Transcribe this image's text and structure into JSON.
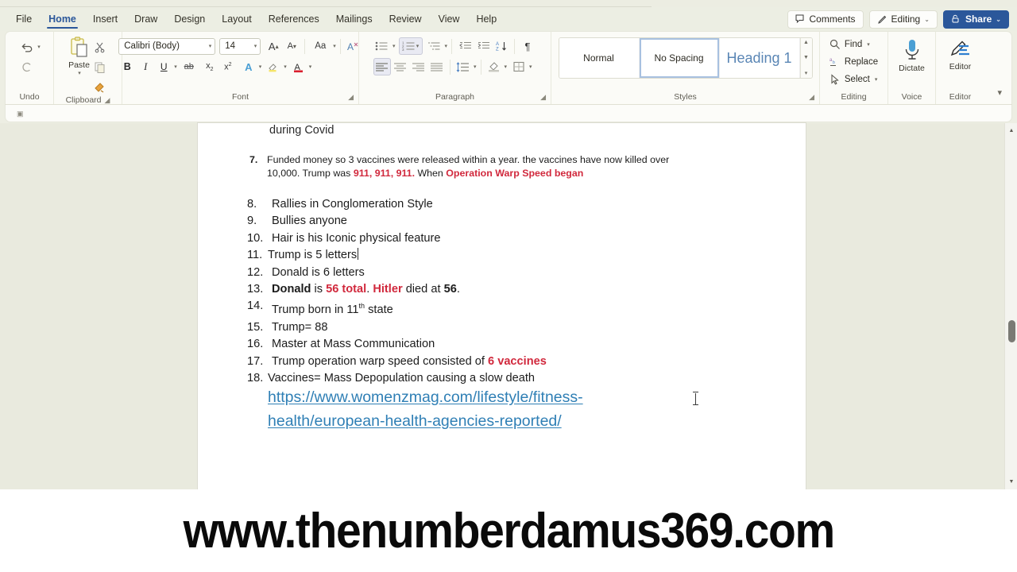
{
  "app": {
    "name": "Microsoft Word",
    "theme_accent": "#2b579a",
    "canvas_bg": "#e9eade",
    "ribbon_bg": "#fbfbf7"
  },
  "tabs": [
    {
      "label": "File",
      "active": false
    },
    {
      "label": "Home",
      "active": true
    },
    {
      "label": "Insert",
      "active": false
    },
    {
      "label": "Draw",
      "active": false
    },
    {
      "label": "Design",
      "active": false
    },
    {
      "label": "Layout",
      "active": false
    },
    {
      "label": "References",
      "active": false
    },
    {
      "label": "Mailings",
      "active": false
    },
    {
      "label": "Review",
      "active": false
    },
    {
      "label": "View",
      "active": false
    },
    {
      "label": "Help",
      "active": false
    }
  ],
  "titlebar_actions": {
    "comments": {
      "label": "Comments",
      "icon": "comment-icon"
    },
    "editing": {
      "label": "Editing",
      "icon": "pencil-icon",
      "caret": "⌄"
    },
    "share": {
      "label": "Share",
      "icon": "share-lock-icon",
      "caret": "⌄"
    }
  },
  "ribbon": {
    "groups": [
      {
        "name": "Undo",
        "label": "Undo",
        "items": [
          {
            "name": "undo-button",
            "icon": "undo-arrow-icon",
            "caret": "⌄"
          },
          {
            "name": "redo-button",
            "icon": "redo-arrow-icon"
          }
        ]
      },
      {
        "name": "Clipboard",
        "label": "Clipboard",
        "items": [
          {
            "name": "paste-button",
            "label": "Paste",
            "icon": "clipboard-icon",
            "caret": "⌄"
          },
          {
            "name": "cut-button",
            "icon": "scissors-icon"
          },
          {
            "name": "copy-button",
            "icon": "copy-icon"
          },
          {
            "name": "format-painter-button",
            "icon": "format-painter-icon"
          }
        ]
      },
      {
        "name": "Font",
        "label": "Font",
        "font_name": "Calibri (Body)",
        "font_size": "14",
        "items": [
          {
            "name": "grow-font-button",
            "label": "A",
            "icon": "grow-font-icon"
          },
          {
            "name": "shrink-font-button",
            "label": "A",
            "icon": "shrink-font-icon"
          },
          {
            "name": "change-case-button",
            "label": "Aa",
            "icon": "change-case-icon"
          },
          {
            "name": "clear-formatting-button",
            "icon": "clear-formatting-icon"
          },
          {
            "name": "bold-button",
            "label": "B",
            "icon": "bold-icon"
          },
          {
            "name": "italic-button",
            "label": "I",
            "icon": "italic-icon"
          },
          {
            "name": "underline-button",
            "label": "U",
            "icon": "underline-icon"
          },
          {
            "name": "strikethrough-button",
            "label": "ab",
            "icon": "strikethrough-icon"
          },
          {
            "name": "subscript-button",
            "label": "x",
            "icon": "subscript-icon"
          },
          {
            "name": "superscript-button",
            "label": "x",
            "icon": "superscript-icon"
          },
          {
            "name": "text-effects-button",
            "label": "A",
            "icon": "text-effects-icon"
          },
          {
            "name": "text-highlight-button",
            "label": "",
            "icon": "highlighter-icon"
          },
          {
            "name": "font-color-button",
            "label": "A",
            "icon": "font-color-icon"
          }
        ]
      },
      {
        "name": "Paragraph",
        "label": "Paragraph",
        "items": [
          {
            "name": "bullets-button",
            "icon": "bullet-list-icon"
          },
          {
            "name": "numbering-button",
            "icon": "numbered-list-icon",
            "selected": true
          },
          {
            "name": "multilevel-list-button",
            "icon": "multilevel-list-icon"
          },
          {
            "name": "decrease-indent-button",
            "icon": "decrease-indent-icon"
          },
          {
            "name": "increase-indent-button",
            "icon": "increase-indent-icon"
          },
          {
            "name": "sort-button",
            "icon": "sort-az-icon"
          },
          {
            "name": "show-marks-button",
            "icon": "pilcrow-icon"
          },
          {
            "name": "align-left-button",
            "icon": "align-left-icon",
            "selected": true
          },
          {
            "name": "align-center-button",
            "icon": "align-center-icon"
          },
          {
            "name": "align-right-button",
            "icon": "align-right-icon"
          },
          {
            "name": "justify-button",
            "icon": "justify-icon"
          },
          {
            "name": "line-spacing-button",
            "icon": "line-spacing-icon"
          },
          {
            "name": "shading-button",
            "icon": "shading-bucket-icon"
          },
          {
            "name": "borders-button",
            "icon": "borders-grid-icon"
          }
        ]
      },
      {
        "name": "Styles",
        "label": "Styles",
        "gallery": [
          {
            "label": "Normal",
            "selected": false
          },
          {
            "label": "No Spacing",
            "selected": true
          },
          {
            "label": "Heading 1",
            "selected": false
          }
        ]
      },
      {
        "name": "Editing",
        "label": "Editing",
        "items": [
          {
            "name": "find-button",
            "label": "Find",
            "icon": "magnifier-icon",
            "caret": "⌄"
          },
          {
            "name": "replace-button",
            "label": "Replace",
            "icon": "replace-icon"
          },
          {
            "name": "select-button",
            "label": "Select",
            "icon": "cursor-arrow-icon",
            "caret": "⌄"
          }
        ]
      },
      {
        "name": "Voice",
        "label": "Voice",
        "items": [
          {
            "name": "dictate-button",
            "label": "Dictate",
            "icon": "microphone-icon"
          }
        ]
      },
      {
        "name": "Editor",
        "label": "Editor",
        "items": [
          {
            "name": "editor-button",
            "label": "Editor",
            "icon": "editor-pen-icon"
          }
        ]
      }
    ],
    "collapse_icon": "chevron-down-icon"
  },
  "document": {
    "clipped_top_line": "during Covid",
    "item7": {
      "number": "7.",
      "segments": [
        {
          "text": "Funded money so 3 vaccines were released within a year. the vaccines have now killed over 10,000. Trump was ",
          "style": "normal"
        },
        {
          "text": "911, 911, 911.",
          "style": "red-bold"
        },
        {
          "text": " When ",
          "style": "normal"
        },
        {
          "text": "Operation Warp Speed began",
          "style": "red-bold"
        }
      ]
    },
    "list": [
      {
        "number": "8.",
        "segments": [
          {
            "text": "Rallies in Conglomeration Style",
            "style": "normal"
          }
        ]
      },
      {
        "number": "9.",
        "segments": [
          {
            "text": "Bullies anyone",
            "style": "normal"
          }
        ]
      },
      {
        "number": "10.",
        "segments": [
          {
            "text": "Hair is his Iconic physical feature",
            "style": "normal"
          }
        ]
      },
      {
        "number": "11.",
        "tight": true,
        "caret_after": true,
        "segments": [
          {
            "text": "Trump is 5 letters",
            "style": "normal"
          }
        ]
      },
      {
        "number": "12.",
        "segments": [
          {
            "text": "Donald is 6 letters",
            "style": "normal"
          }
        ]
      },
      {
        "number": "13.",
        "segments": [
          {
            "text": "Donald",
            "style": "bold"
          },
          {
            "text": " is ",
            "style": "normal"
          },
          {
            "text": "56 total",
            "style": "red-bold"
          },
          {
            "text": ". ",
            "style": "normal"
          },
          {
            "text": "Hitler",
            "style": "red-bold"
          },
          {
            "text": " died at ",
            "style": "normal"
          },
          {
            "text": "56",
            "style": "bold"
          },
          {
            "text": ".",
            "style": "normal"
          }
        ]
      },
      {
        "number": "14.",
        "segments": [
          {
            "text": "Trump born in 11",
            "style": "normal"
          },
          {
            "text": "th",
            "style": "sup"
          },
          {
            "text": " state",
            "style": "normal"
          }
        ]
      },
      {
        "number": "15.",
        "segments": [
          {
            "text": "Trump= 88",
            "style": "normal"
          }
        ]
      },
      {
        "number": "16.",
        "segments": [
          {
            "text": "Master at Mass Communication",
            "style": "normal"
          }
        ]
      },
      {
        "number": "17.",
        "segments": [
          {
            "text": "Trump operation warp speed consisted of ",
            "style": "normal"
          },
          {
            "text": "6 vaccines",
            "style": "red-bold"
          }
        ]
      },
      {
        "number": "18.",
        "tight": true,
        "segments": [
          {
            "text": "Vaccines= Mass Depopulation causing a slow death",
            "style": "normal"
          }
        ]
      }
    ],
    "hyperlink": "https://www.womenzmag.com/lifestyle/fitness-health/european-health-agencies-reported/",
    "hyperlink_color": "#2f7fb5",
    "red_color": "#d1293d"
  },
  "scrollbar": {
    "up_arrow": "▲",
    "down_arrow": "▼"
  },
  "banner": {
    "text": "www.thenumberdamus369.com"
  }
}
